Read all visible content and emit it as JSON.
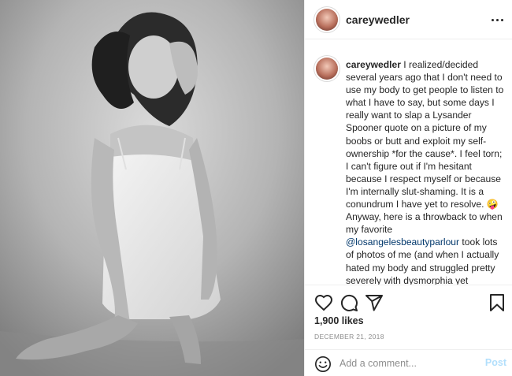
{
  "post": {
    "username": "careywedler",
    "photo_alt": "Black and white photo of a woman kneeling in a white slip dress"
  },
  "caption": {
    "username": "careywedler",
    "text_part1": " I realized/decided several years ago that I don't need to use my body to get people to listen to what I have to say, but some days I really want to slap a Lysander Spooner quote on a picture of my boobs or butt and exploit my self-ownership *for the cause*. I feel torn; I can't figure out if I'm hesitant because I respect myself or because I'm internally slut-shaming. It is a conundrum I have yet to resolve. 🤪 Anyway, here is a throwback to when my favorite ",
    "mention": "@losangelesbeautyparlour",
    "text_part2": " took lots of photos of me (and when I actually hated my body and struggled pretty severely with dysmorphia yet paradoxically showed my body off all the time). Decisions, decisions, but I"
  },
  "stats": {
    "likes": "1,900 likes",
    "date": "DECEMBER 21, 2018"
  },
  "comment": {
    "placeholder": "Add a comment...",
    "post_label": "Post"
  },
  "icons": {
    "like": "heart-icon",
    "comment": "comment-icon",
    "share": "share-icon",
    "save": "bookmark-icon",
    "emoji": "emoji-icon",
    "more": "more-options-icon"
  },
  "colors": {
    "text": "#262626",
    "muted": "#8e8e8e",
    "mention": "#00376b",
    "post_button": "#b2dffc",
    "divider": "#efefef"
  }
}
